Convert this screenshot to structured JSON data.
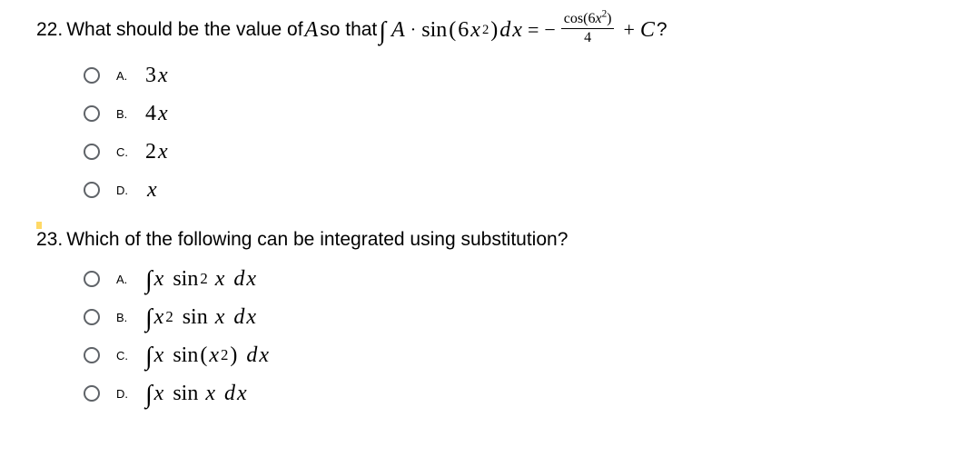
{
  "q22": {
    "number": "22.",
    "text_before": "What should be the value of ",
    "A": "A",
    "text_mid": " so that ",
    "int": "∫",
    "expr_A": "A",
    "dot": "·",
    "sin": "sin",
    "lpar": "(",
    "six": "6",
    "x": "x",
    "sq": "2",
    "rpar": ")",
    "dx_d": "d",
    "dx_x": "x",
    "equals": "=",
    "minus": "−",
    "frac_num_cos": "cos",
    "frac_num_lp": "(",
    "frac_num_6": "6",
    "frac_num_x": "x",
    "frac_num_sq": "2",
    "frac_num_rp": ")",
    "frac_den": "4",
    "plus": "+",
    "C": "C",
    "qmark": "?",
    "options": [
      {
        "letter": "A.",
        "coef": "3",
        "var": "x"
      },
      {
        "letter": "B.",
        "coef": "4",
        "var": "x"
      },
      {
        "letter": "C.",
        "coef": "2",
        "var": "x"
      },
      {
        "letter": "D.",
        "coef": "",
        "var": "x"
      }
    ]
  },
  "q23": {
    "number": "23.",
    "text": "Which of the following can be integrated using substitution?",
    "options": [
      {
        "letter": "A.",
        "int": "∫",
        "x1": "x",
        "sin": "sin",
        "sq_on_sin": "2",
        "x2": "x",
        "dx_d": "d",
        "dx_x": "x"
      },
      {
        "letter": "B.",
        "int": "∫",
        "x1": "x",
        "sq_on_x": "2",
        "sin": "sin",
        "x2": "x",
        "dx_d": "d",
        "dx_x": "x"
      },
      {
        "letter": "C.",
        "int": "∫",
        "x1": "x",
        "sin": "sin",
        "lp": "(",
        "x2": "x",
        "sq_on_x2": "2",
        "rp": ")",
        "dx_d": "d",
        "dx_x": "x"
      },
      {
        "letter": "D.",
        "int": "∫",
        "x1": "x",
        "sin": "sin",
        "x2": "x",
        "dx_d": "d",
        "dx_x": "x"
      }
    ]
  }
}
